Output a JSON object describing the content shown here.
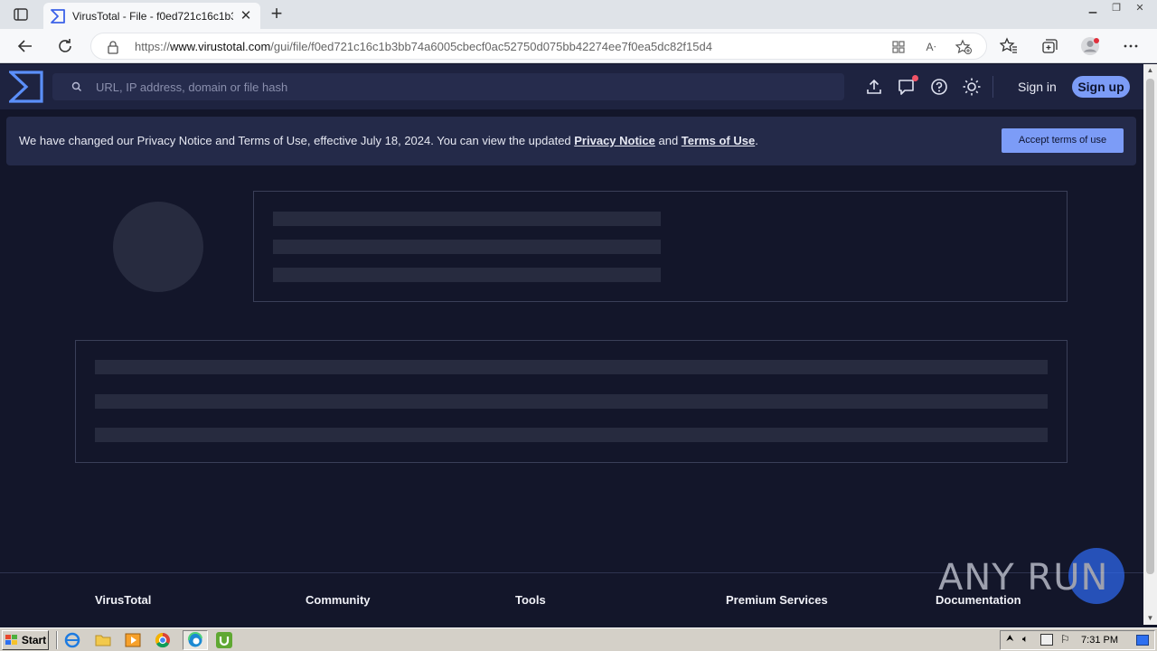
{
  "browser": {
    "tab_title": "VirusTotal - File - f0ed721c16c1b3",
    "url_prefix": "https://",
    "url_domain": "www.virustotal.com",
    "url_path": "/gui/file/f0ed721c16c1b3bb74a6005cbecf0ac52750d075bb42274ee7f0ea5dc82f15d4",
    "icons": [
      "window-menu-icon",
      "tab-favicon-icon",
      "close-tab-icon",
      "new-tab-icon",
      "back-icon",
      "refresh-icon",
      "lock-icon",
      "apps-icon",
      "read-aloud-icon",
      "add-favorite-icon",
      "favorites-icon",
      "collections-icon",
      "profile-icon",
      "more-icon"
    ]
  },
  "header": {
    "search_placeholder": "URL, IP address, domain or file hash",
    "signin_label": "Sign in",
    "signup_label": "Sign up",
    "icons": [
      "upload-icon",
      "chat-icon",
      "help-icon",
      "theme-icon"
    ]
  },
  "notice": {
    "text_before": "We have changed our Privacy Notice and Terms of Use, effective July 18, 2024. You can view the updated ",
    "privacy_link": "Privacy Notice",
    "text_and": " and ",
    "terms_link": "Terms of Use",
    "text_end": ".",
    "accept_label": "Accept terms of use"
  },
  "footer": {
    "columns": [
      "VirusTotal",
      "Community",
      "Tools",
      "Premium Services",
      "Documentation"
    ]
  },
  "watermark": {
    "text": "ANY RUN"
  },
  "taskbar": {
    "start_label": "Start",
    "time": "7:31 PM"
  },
  "colors": {
    "page_bg": "#13162a",
    "header_bg": "#1e2340",
    "accent": "#7c9cf7",
    "skeleton": "#272b3f"
  }
}
